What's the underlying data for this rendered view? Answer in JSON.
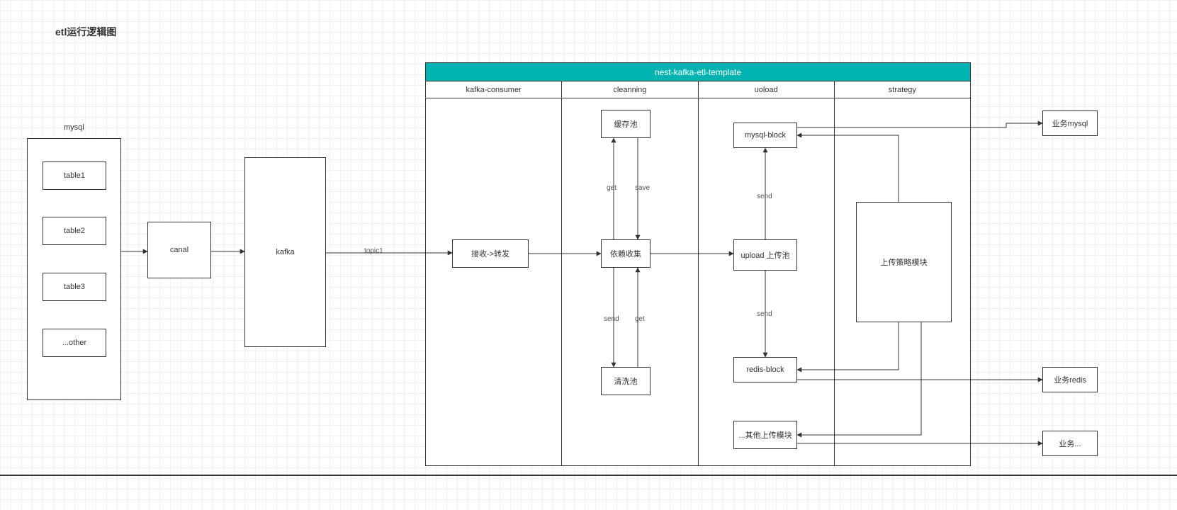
{
  "title": "etl运行逻辑图",
  "mysql": {
    "label": "mysql",
    "tables": [
      "table1",
      "table2",
      "table3",
      "...other"
    ]
  },
  "canal": "canal",
  "kafka": "kafka",
  "topic": "topic1",
  "swimlane": {
    "title": "nest-kafka-etl-template",
    "lanes": {
      "consumer": "kafka-consumer",
      "cleanning": "cleanning",
      "upload": "uoload",
      "strategy": "strategy"
    }
  },
  "nodes": {
    "receive": "接收->转发",
    "cache_pool": "缓存池",
    "dep_collect": "依赖收集",
    "wash_pool": "清洗池",
    "mysql_block": "mysql-block",
    "upload_pool": "upload 上传池",
    "redis_block": "redis-block",
    "other_upload": "...其他上传模块",
    "strategy_module": "上传策略模块"
  },
  "edge_labels": {
    "get1": "get",
    "save": "save",
    "send1": "send",
    "get2": "get",
    "send_up1": "send",
    "send_up2": "send"
  },
  "external": {
    "biz_mysql": "业务mysql",
    "biz_redis": "业务redis",
    "biz_other": "业务..."
  }
}
